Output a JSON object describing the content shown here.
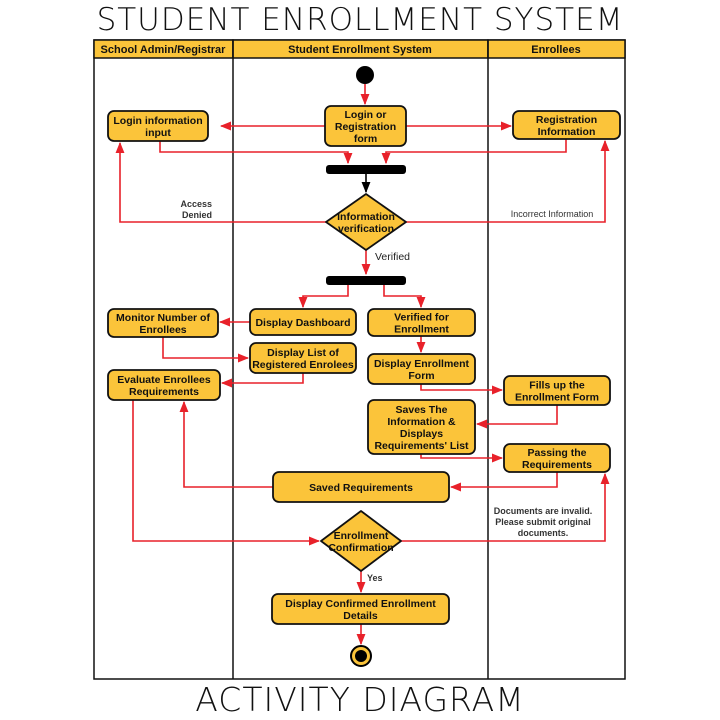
{
  "title": "STUDENT ENROLLMENT SYSTEM",
  "subtitle": "ACTIVITY DIAGRAM",
  "colors": {
    "node_fill": "#fbc43a",
    "node_stroke": "#111111",
    "edge": "#e8212a",
    "lane_header": "#fbc43a",
    "bar": "#000000"
  },
  "lanes": [
    {
      "id": "admin",
      "label": "School Admin/Registrar"
    },
    {
      "id": "system",
      "label": "Student Enrollment System"
    },
    {
      "id": "enrollees",
      "label": "Enrollees"
    }
  ],
  "nodes": [
    {
      "id": "start",
      "type": "initial",
      "lane": "system"
    },
    {
      "id": "login_reg_form",
      "type": "action",
      "lane": "system",
      "lines": [
        "Login or",
        "Registration",
        "form"
      ]
    },
    {
      "id": "login_input",
      "type": "action",
      "lane": "admin",
      "lines": [
        "Login information",
        "input"
      ]
    },
    {
      "id": "reg_info",
      "type": "action",
      "lane": "enrollees",
      "lines": [
        "Registration",
        "Information"
      ]
    },
    {
      "id": "join1",
      "type": "bar",
      "lane": "system"
    },
    {
      "id": "info_verify",
      "type": "decision",
      "lane": "system",
      "lines": [
        "Information",
        "verification"
      ]
    },
    {
      "id": "fork1",
      "type": "bar",
      "lane": "system"
    },
    {
      "id": "display_dashboard",
      "type": "action",
      "lane": "system",
      "lines": [
        "Display Dashboard"
      ]
    },
    {
      "id": "verified_enroll",
      "type": "action",
      "lane": "system",
      "lines": [
        "Verified for",
        "Enrollment"
      ]
    },
    {
      "id": "monitor_enrollees",
      "type": "action",
      "lane": "admin",
      "lines": [
        "Monitor Number of",
        "Enrollees"
      ]
    },
    {
      "id": "display_list",
      "type": "action",
      "lane": "system",
      "lines": [
        "Display List of",
        "Registered Enrolees"
      ]
    },
    {
      "id": "display_form",
      "type": "action",
      "lane": "system",
      "lines": [
        "Display Enrollment",
        "Form"
      ]
    },
    {
      "id": "evaluate_req",
      "type": "action",
      "lane": "admin",
      "lines": [
        "Evaluate Enrollees",
        "Requirements"
      ]
    },
    {
      "id": "fills_form",
      "type": "action",
      "lane": "enrollees",
      "lines": [
        "Fills up the",
        "Enrollment Form"
      ]
    },
    {
      "id": "saves_info",
      "type": "action",
      "lane": "system",
      "lines": [
        "Saves The",
        "Information &",
        "Displays",
        "Requirements' List"
      ]
    },
    {
      "id": "passing_req",
      "type": "action",
      "lane": "enrollees",
      "lines": [
        "Passing the",
        "Requirements"
      ]
    },
    {
      "id": "saved_req",
      "type": "action",
      "lane": "system",
      "lines": [
        "Saved Requirements"
      ]
    },
    {
      "id": "enroll_confirm",
      "type": "decision",
      "lane": "system",
      "lines": [
        "Enrollment",
        "Confirmation"
      ]
    },
    {
      "id": "display_confirmed",
      "type": "action",
      "lane": "system",
      "lines": [
        "Display Confirmed Enrollment",
        "Details"
      ]
    },
    {
      "id": "end",
      "type": "final",
      "lane": "system"
    }
  ],
  "edges": [
    {
      "from": "start",
      "to": "login_reg_form",
      "label": ""
    },
    {
      "from": "login_reg_form",
      "to": "login_input",
      "label": ""
    },
    {
      "from": "login_reg_form",
      "to": "reg_info",
      "label": ""
    },
    {
      "from": "login_input",
      "to": "join1",
      "label": ""
    },
    {
      "from": "reg_info",
      "to": "join1",
      "label": ""
    },
    {
      "from": "join1",
      "to": "info_verify",
      "label": ""
    },
    {
      "from": "info_verify",
      "to": "login_input",
      "label": "Access Denied"
    },
    {
      "from": "info_verify",
      "to": "reg_info",
      "label": "Incorrect Information"
    },
    {
      "from": "info_verify",
      "to": "fork1",
      "label": "Verified"
    },
    {
      "from": "fork1",
      "to": "display_dashboard",
      "label": ""
    },
    {
      "from": "fork1",
      "to": "verified_enroll",
      "label": ""
    },
    {
      "from": "display_dashboard",
      "to": "monitor_enrollees",
      "label": ""
    },
    {
      "from": "monitor_enrollees",
      "to": "display_list",
      "label": ""
    },
    {
      "from": "display_list",
      "to": "evaluate_req",
      "label": ""
    },
    {
      "from": "verified_enroll",
      "to": "display_form",
      "label": ""
    },
    {
      "from": "display_form",
      "to": "fills_form",
      "label": ""
    },
    {
      "from": "fills_form",
      "to": "saves_info",
      "label": ""
    },
    {
      "from": "saves_info",
      "to": "passing_req",
      "label": ""
    },
    {
      "from": "passing_req",
      "to": "saved_req",
      "label": ""
    },
    {
      "from": "saved_req",
      "to": "evaluate_req",
      "label": ""
    },
    {
      "from": "evaluate_req",
      "to": "enroll_confirm",
      "label": ""
    },
    {
      "from": "enroll_confirm",
      "to": "passing_req",
      "label_lines": [
        "Documents are invalid.",
        "Please submit original",
        "documents."
      ]
    },
    {
      "from": "enroll_confirm",
      "to": "display_confirmed",
      "label": "Yes"
    },
    {
      "from": "display_confirmed",
      "to": "end",
      "label": ""
    }
  ]
}
